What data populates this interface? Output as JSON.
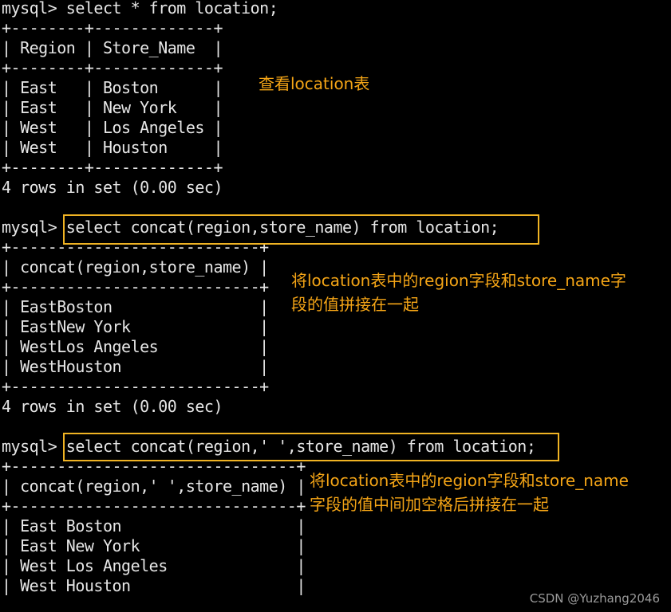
{
  "terminal": {
    "lines": [
      "mysql> select * from location;",
      "+--------+-------------+",
      "| Region | Store_Name  |",
      "+--------+-------------+",
      "| East   | Boston      |",
      "| East   | New York    |",
      "| West   | Los Angeles |",
      "| West   | Houston     |",
      "+--------+-------------+",
      "4 rows in set (0.00 sec)",
      "",
      "mysql> select concat(region,store_name) from location;",
      "+---------------------------+",
      "| concat(region,store_name) |",
      "+---------------------------+",
      "| EastBoston                |",
      "| EastNew York              |",
      "| WestLos Angeles           |",
      "| WestHouston               |",
      "+---------------------------+",
      "4 rows in set (0.00 sec)",
      "",
      "mysql> select concat(region,' ',store_name) from location;",
      "+-------------------------------+",
      "| concat(region,' ',store_name) |",
      "+-------------------------------+",
      "| East Boston                   |",
      "| East New York                 |",
      "| West Los Angeles              |",
      "| West Houston                  |"
    ]
  },
  "annotations": {
    "a1": "查看location表",
    "a2_line1": "将location表中的region字段和store_name字",
    "a2_line2": "段的值拼接在一起",
    "a3_line1": "将location表中的region字段和store_name",
    "a3_line2": "字段的值中间加空格后拼接在一起"
  },
  "watermark": "CSDN @Yuzhang2046",
  "colors": {
    "background": "#000000",
    "terminal_text": "#e6e6e6",
    "annotation_text": "#f5a516",
    "highlight_border": "#f0b323"
  }
}
